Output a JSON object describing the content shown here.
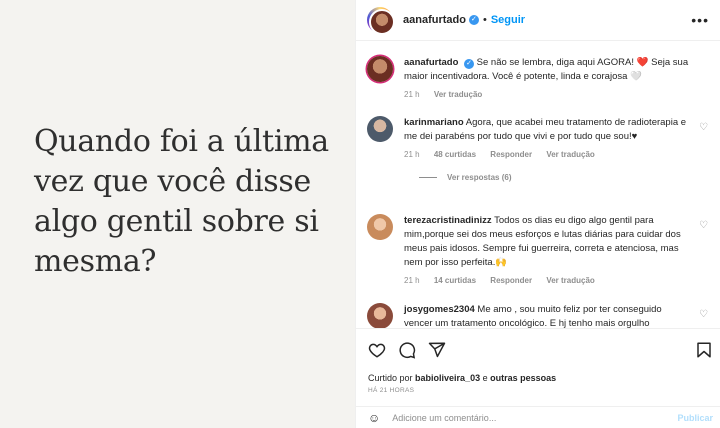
{
  "post": {
    "quote": "Quando foi a última vez que você disse algo gentil sobre si mesma?"
  },
  "header": {
    "username": "aanafurtado",
    "follow": "Seguir"
  },
  "caption": {
    "username": "aanafurtado",
    "text": "Se não se lembra, diga aqui AGORA! ❤️ Seja sua maior incentivadora. Você é potente, linda e corajosa 🤍",
    "time": "21 h",
    "translate": "Ver tradução"
  },
  "comments": [
    {
      "username": "karinmariano",
      "text": "Agora, que acabei meu tratamento de radioterapia e me dei parabéns por tudo que vivi e por tudo que sou!♥",
      "time": "21 h",
      "likes": "48 curtidas",
      "reply": "Responder",
      "translate": "Ver tradução",
      "view_replies": "Ver respostas (6)"
    },
    {
      "username": "terezacristinadinizz",
      "text": "Todos os dias eu digo algo gentil para mim,porque sei dos meus esforços e lutas diárias para cuidar dos meus pais idosos. Sempre fui guerreira, correta e atenciosa, mas nem por isso perfeita.🙌",
      "time": "21 h",
      "likes": "14 curtidas",
      "reply": "Responder",
      "translate": "Ver tradução"
    },
    {
      "username": "josygomes2304",
      "text": "Me amo , sou muito feliz por ter conseguido vencer um tratamento oncológico. E hj tenho mais orgulho"
    }
  ],
  "actions": {
    "liked_prefix": "Curtido por",
    "liked_user": "babioliveira_03",
    "liked_suffix": "e",
    "liked_others": "outras pessoas",
    "time": "HÁ 21 HORAS",
    "comment_placeholder": "Adicione um comentário...",
    "publish": "Publicar"
  }
}
